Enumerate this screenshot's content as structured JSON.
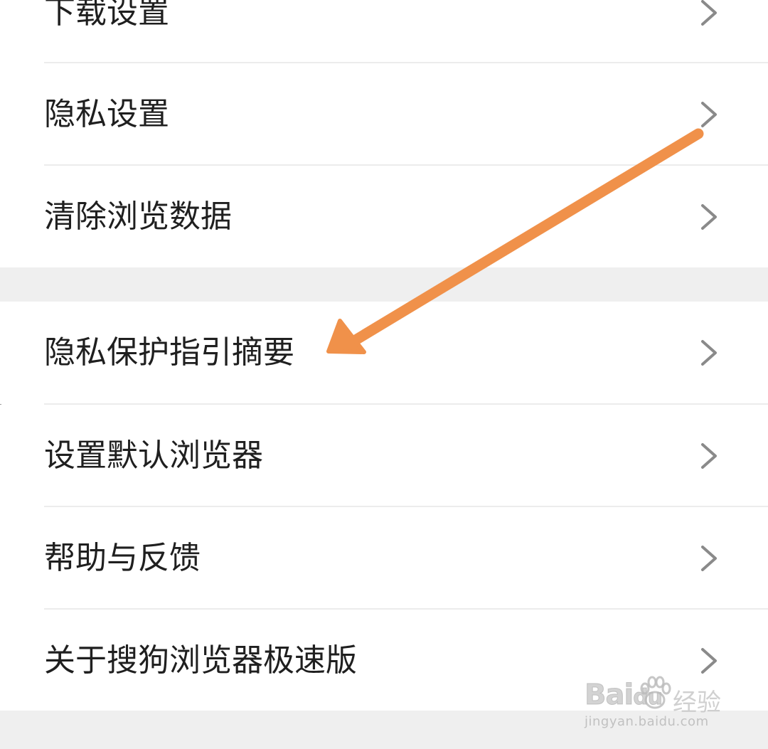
{
  "menu_groups": [
    {
      "items": [
        {
          "label": "下载设置"
        },
        {
          "label": "隐私设置"
        },
        {
          "label": "清除浏览数据"
        }
      ]
    },
    {
      "items": [
        {
          "label": "隐私保护指引摘要"
        },
        {
          "label": "设置默认浏览器"
        },
        {
          "label": "帮助与反馈"
        },
        {
          "label": "关于搜狗浏览器极速版"
        }
      ]
    }
  ],
  "annotation": {
    "arrow_color": "#f0914a",
    "points_to": "隐私保护指引摘要"
  },
  "watermark": {
    "brand": "Bai",
    "brand_tail": "du",
    "name": "经验",
    "url": "jingyan.baidu.com"
  },
  "icons": {
    "row_chevron": "chevron-right-icon",
    "watermark_mark": "paw-icon"
  },
  "colors": {
    "text": "#1f1f1f",
    "chevron": "#8a8a8a",
    "section_gap": "#efefef",
    "divider": "#ececec"
  }
}
